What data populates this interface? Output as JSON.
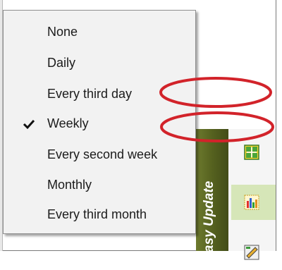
{
  "menu": {
    "items": [
      {
        "label": "None",
        "checked": false
      },
      {
        "label": "Daily",
        "checked": false
      },
      {
        "label": "Every third day",
        "checked": false
      },
      {
        "label": "Weekly",
        "checked": true
      },
      {
        "label": "Every second week",
        "checked": false
      },
      {
        "label": "Monthly",
        "checked": false
      },
      {
        "label": "Every third month",
        "checked": false
      }
    ]
  },
  "sidebar": {
    "label": "asy Update",
    "color": "#55611f"
  },
  "toolbar": {
    "icons": [
      "grid-arrows-icon",
      "bar-chart-icon",
      "pencil-chart-icon"
    ],
    "active_index": 1
  },
  "annotations": {
    "color": "#d2232a"
  }
}
